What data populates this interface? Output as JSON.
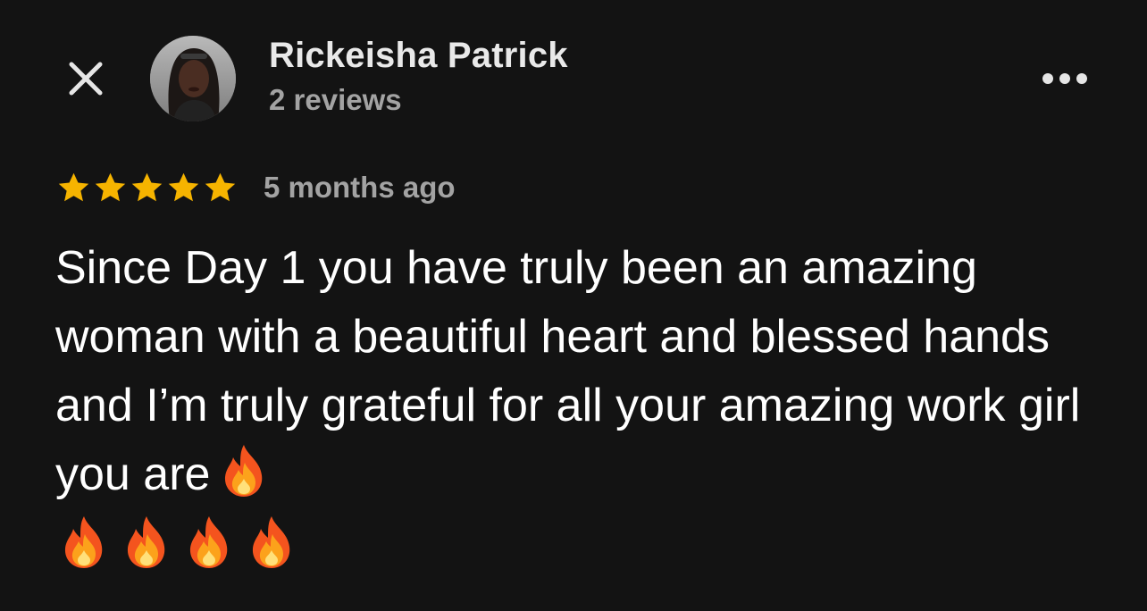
{
  "header": {
    "close_icon": "close-icon",
    "reviewer_name": "Rickeisha Patrick",
    "review_count": "2 reviews",
    "more_icon": "more-horizontal-icon"
  },
  "review": {
    "rating": 5,
    "rating_max": 5,
    "star_color": "#f6b400",
    "timestamp": "5 months ago",
    "text": "Since Day 1 you have truly been an amazing woman with a beautiful heart and blessed hands and I’m truly grateful for all your amazing work girl you are",
    "trailing_emoji": [
      "🔥",
      "🔥",
      "🔥",
      "🔥",
      "🔥"
    ]
  },
  "colors": {
    "background": "#131313",
    "primary_text": "#ffffff",
    "secondary_text": "#a3a3a3"
  }
}
